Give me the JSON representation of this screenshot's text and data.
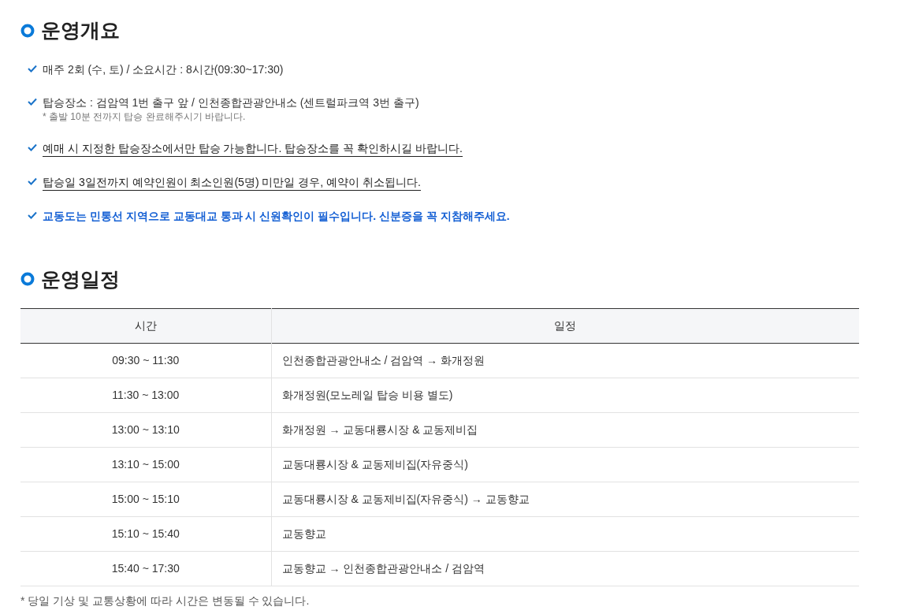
{
  "overview": {
    "title": "운영개요",
    "items": [
      {
        "kind": "plain",
        "text": "매주 2회 (수, 토) / 소요시간 : 8시간(09:30~17:30)"
      },
      {
        "kind": "plain",
        "text": "탑승장소 : 검암역 1번 출구 앞 / 인천종합관광안내소 (센트럴파크역 3번 출구)",
        "note": "* 출발 10분 전까지 탑승 완료해주시기 바랍니다."
      },
      {
        "kind": "underlined",
        "text": "예매 시 지정한 탑승장소에서만 탑승 가능합니다. 탑승장소를 꼭 확인하시길 바랍니다."
      },
      {
        "kind": "underlined",
        "text": "탑승일 3일전까지 예약인원이 최소인원(5명) 미만일 경우, 예약이 취소됩니다."
      },
      {
        "kind": "highlight",
        "text": "교동도는 민통선 지역으로 교동대교 통과 시 신원확인이 필수입니다. 신분증을 꼭 지참해주세요."
      }
    ]
  },
  "schedule": {
    "title": "운영일정",
    "table": {
      "columns": [
        "시간",
        "일정"
      ],
      "rows": [
        [
          "09:30 ~ 11:30",
          "인천종합관광안내소 / 검암역 → 화개정원"
        ],
        [
          "11:30 ~ 13:00",
          "화개정원(모노레일 탑승 비용 별도)"
        ],
        [
          "13:00 ~ 13:10",
          "화개정원 → 교동대룡시장 & 교동제비집"
        ],
        [
          "13:10 ~ 15:00",
          "교동대룡시장 & 교동제비집(자유중식)"
        ],
        [
          "15:00 ~ 15:10",
          "교동대룡시장 & 교동제비집(자유중식) → 교동향교"
        ],
        [
          "15:10 ~ 15:40",
          "교동향교"
        ],
        [
          "15:40 ~ 17:30",
          "교동향교 → 인천종합관광안내소 / 검암역"
        ]
      ]
    },
    "footnote": "* 당일 기상 및 교통상황에 따라 시간은 변동될 수 있습니다."
  }
}
